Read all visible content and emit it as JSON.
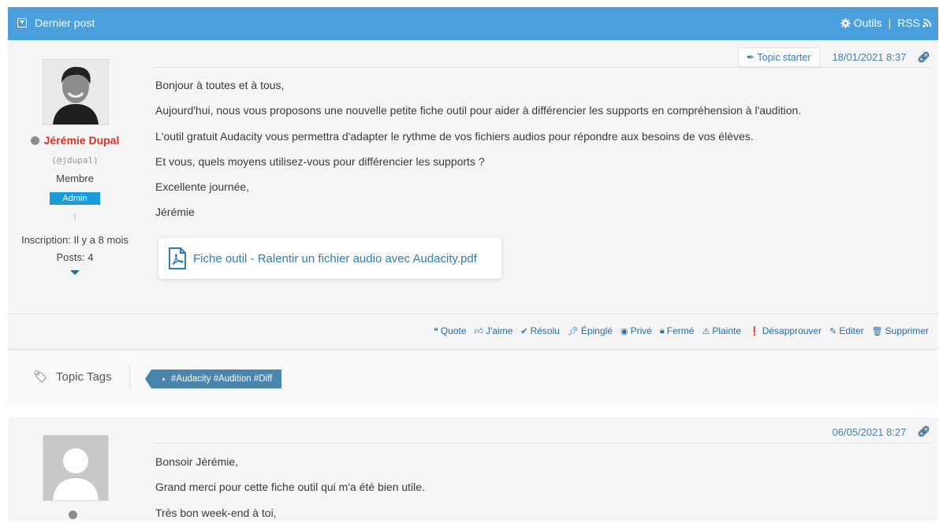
{
  "header": {
    "title": "Dernier post",
    "tools_label": "Outils",
    "separator": "|",
    "rss_label": "RSS"
  },
  "post1": {
    "author": {
      "name": "Jérémie Dupal",
      "handle": "(@jdupal)",
      "role": "Membre",
      "badge": "Admin",
      "registration": "Inscription: Il y a 8 mois",
      "posts": "Posts: 4"
    },
    "topic_starter": "Topic starter",
    "date": "18/01/2021 8:37",
    "paragraphs": [
      "Bonjour à toutes et à tous,",
      "Aujourd'hui, nous vous proposons une nouvelle petite fiche outil pour aider à différencier les supports en compréhension à l'audition.",
      "L'outil gratuit Audacity vous permettra d'adapter le rythme de vos fichiers audios pour répondre aux besoins de vos élèves.",
      "Et vous, quels moyens utilisez-vous pour différencier les supports ?",
      "Excellente journée,",
      "Jérémie"
    ],
    "attachment": "Fiche outil - Ralentir un fichier audio avec Audacity.pdf",
    "actions": [
      "Quote",
      "J'aime",
      "Résolu",
      "Épinglé",
      "Privé",
      "Fermé",
      "Plainte",
      "Désapprouver",
      "Editer",
      "Supprimer"
    ]
  },
  "tags": {
    "label": "Topic Tags",
    "value": "#Audacity #Audition #Diff"
  },
  "post2": {
    "date": "06/05/2021 8:27",
    "paragraphs": [
      "Bonsoir Jérémie,",
      "Grand merci pour cette fiche outil qui m'a été bien utile.",
      "Très bon week-end à toi,"
    ]
  },
  "colors": {
    "header_bg": "#4a9fdc",
    "author_name": "#e02f23",
    "admin_badge": "#1a9ad6",
    "link": "#2f7db2",
    "tag_bg": "#4a85ab"
  }
}
